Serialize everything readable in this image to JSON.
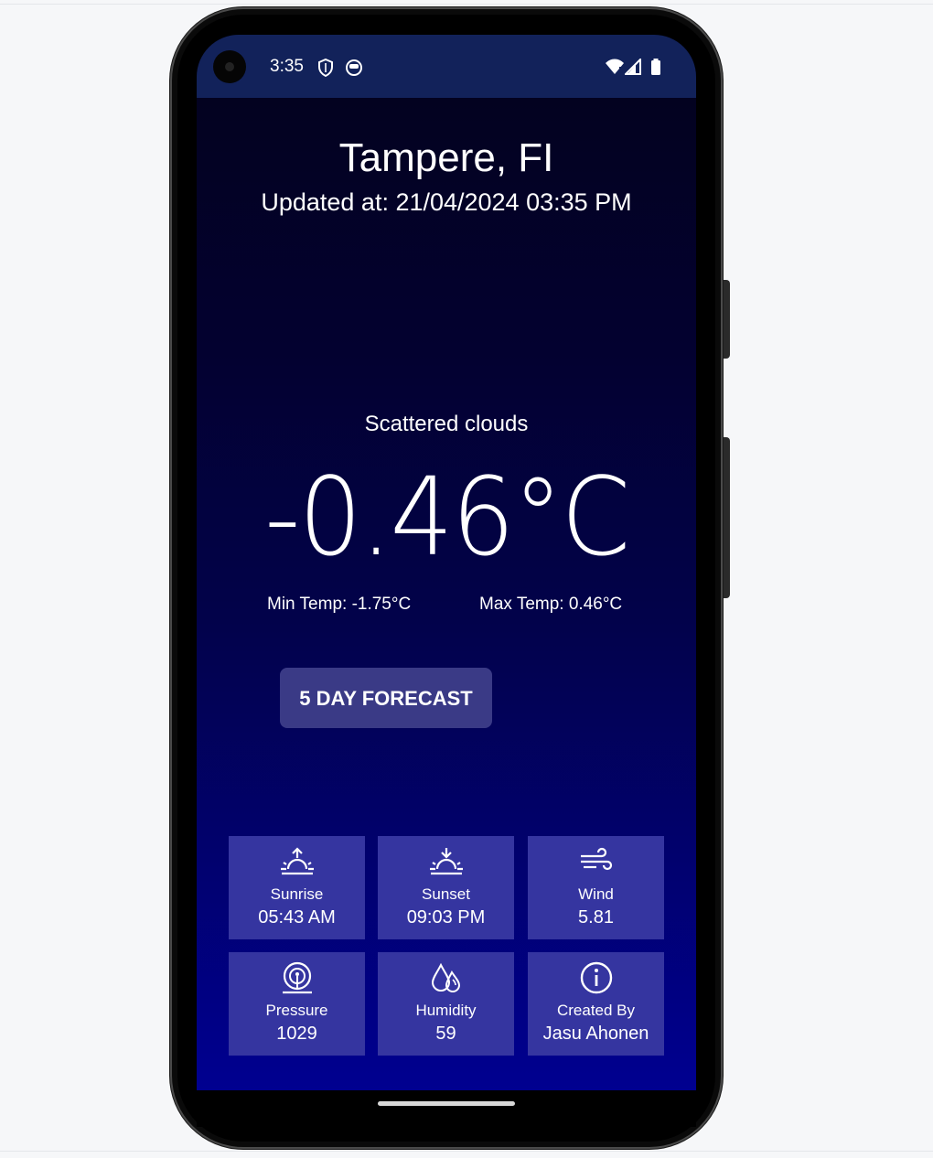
{
  "status_bar": {
    "time": "3:35",
    "icons": [
      "shield-icon",
      "face-icon",
      "wifi-icon",
      "signal-icon",
      "battery-icon"
    ]
  },
  "weather": {
    "city": "Tampere, FI",
    "updated": "Updated at: 21/04/2024 03:35 PM",
    "description": "Scattered clouds",
    "temperature": "-0.46°C",
    "min_temp": "Min Temp: -1.75°C",
    "max_temp": "Max Temp: 0.46°C"
  },
  "forecast_button": {
    "label": "5 DAY FORECAST"
  },
  "tiles": [
    {
      "label": "Sunrise",
      "value": "05:43 AM",
      "icon": "sunrise-icon"
    },
    {
      "label": "Sunset",
      "value": "09:03 PM",
      "icon": "sunset-icon"
    },
    {
      "label": "Wind",
      "value": "5.81",
      "icon": "wind-icon"
    },
    {
      "label": "Pressure",
      "value": "1029",
      "icon": "pressure-icon"
    },
    {
      "label": "Humidity",
      "value": "59",
      "icon": "humidity-icon"
    },
    {
      "label": "Created By",
      "value": "Jasu Ahonen",
      "icon": "info-icon"
    }
  ],
  "colors": {
    "status_bar": "#12225a",
    "tile_background": "#3535a0",
    "button_background": "#3a3a86",
    "gradient_top": "#03021c",
    "gradient_bottom": "#000090"
  }
}
